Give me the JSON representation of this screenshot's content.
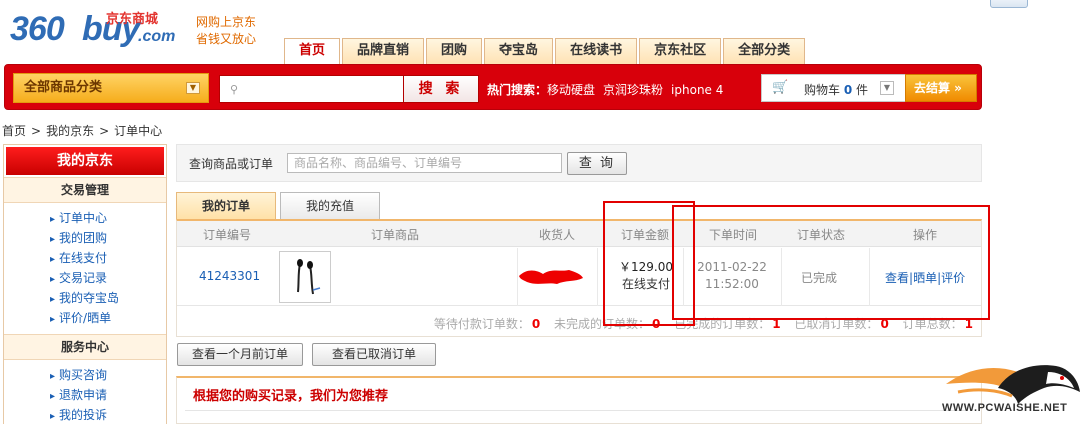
{
  "header": {
    "logo_num": "360",
    "logo_buy": "buy",
    "logo_cn": "京东商城",
    "logo_com": ".com",
    "slogan_line1": "网购上京东",
    "slogan_line2": "省钱又放心"
  },
  "nav": {
    "tabs": [
      "首页",
      "品牌直销",
      "团购",
      "夺宝岛",
      "在线读书",
      "京东社区",
      "全部分类"
    ],
    "active_index": 0
  },
  "searchbar": {
    "all_categories": "全部商品分类",
    "search_placeholder": "",
    "search_button": "搜 索",
    "hot_label": "热门搜索：",
    "hot_terms": [
      "移动硬盘",
      "京润珍珠粉",
      "iphone 4"
    ],
    "cart_label": "购物车",
    "cart_count": "0",
    "cart_unit": "件",
    "checkout": "去结算 »"
  },
  "breadcrumb": [
    "首页",
    "我的京东",
    "订单中心"
  ],
  "sidebar": {
    "title": "我的京东",
    "sections": [
      {
        "name": "交易管理",
        "items": [
          "订单中心",
          "我的团购",
          "在线支付",
          "交易记录",
          "我的夺宝岛",
          "评价/晒单"
        ]
      },
      {
        "name": "服务中心",
        "items": [
          "购买咨询",
          "退款申请",
          "我的投诉"
        ]
      }
    ]
  },
  "query": {
    "label": "查询商品或订单",
    "placeholder": "商品名称、商品编号、订单编号",
    "button": "查 询"
  },
  "subtabs": [
    "我的订单",
    "我的充值"
  ],
  "table": {
    "headers": [
      "订单编号",
      "订单商品",
      "收货人",
      "订单金额",
      "下单时间",
      "订单状态",
      "操作"
    ],
    "row": {
      "order_id": "41243301",
      "amount": "￥129.00",
      "payment": "在线支付",
      "date": "2011-02-22",
      "time": "11:52:00",
      "status": "已完成",
      "op_view": "查看",
      "op_share": "晒单",
      "op_review": "评价",
      "op_sep": "|"
    },
    "summary": [
      {
        "label": "等待付款订单数：",
        "count": "0"
      },
      {
        "label": "未完成的订单数：",
        "count": "0"
      },
      {
        "label": "已完成的订单数：",
        "count": "1"
      },
      {
        "label": "已取消订单数：",
        "count": "0"
      },
      {
        "label": "订单总数：",
        "count": "1"
      }
    ]
  },
  "buttons": {
    "month_ago": "查看一个月前订单",
    "cancelled": "查看已取消订单"
  },
  "recommend": {
    "title": "根据您的购买记录，我们为您推荐"
  },
  "watermark": {
    "text": "WWW.PCWAISHE.NET"
  },
  "colors": {
    "brand_red": "#d8000b",
    "link_blue": "#1a5fb4",
    "annotation_red": "#e20000"
  }
}
